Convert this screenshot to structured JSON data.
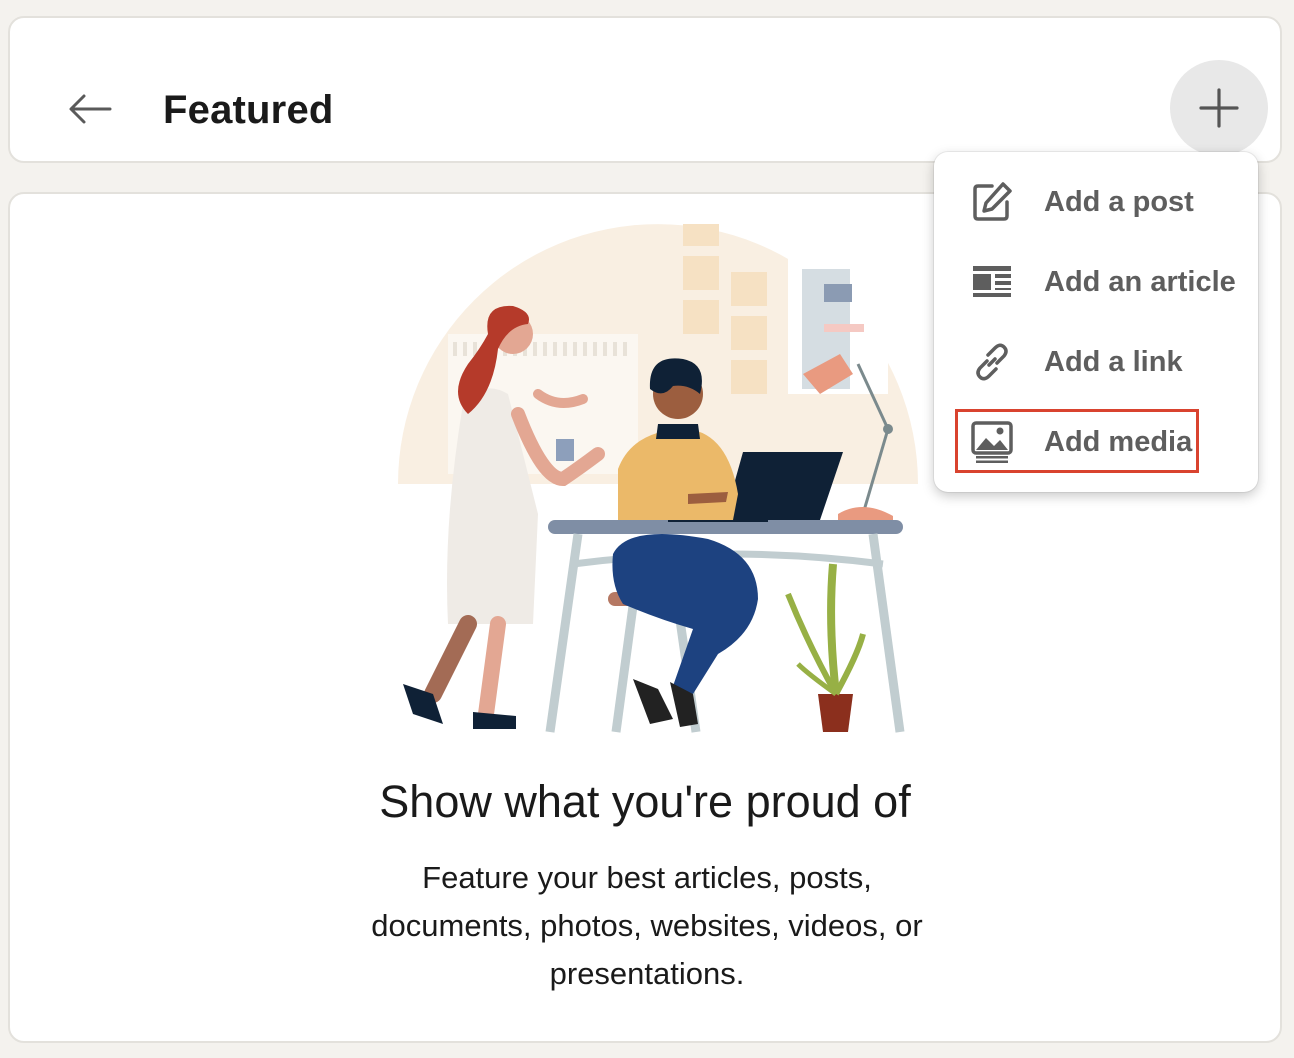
{
  "header": {
    "title": "Featured"
  },
  "menu": {
    "items": [
      {
        "label": "Add a post",
        "icon": "pencil-square-icon"
      },
      {
        "label": "Add an article",
        "icon": "article-icon"
      },
      {
        "label": "Add a link",
        "icon": "link-icon"
      },
      {
        "label": "Add media",
        "icon": "image-icon"
      }
    ]
  },
  "empty_state": {
    "heading": "Show what you're proud of",
    "description": "Feature your best articles, posts, documents, photos, websites, videos, or presentations."
  },
  "colors": {
    "highlight": "#d9432f",
    "menu_text": "#5e5e5e",
    "background": "#f4f2ee"
  }
}
